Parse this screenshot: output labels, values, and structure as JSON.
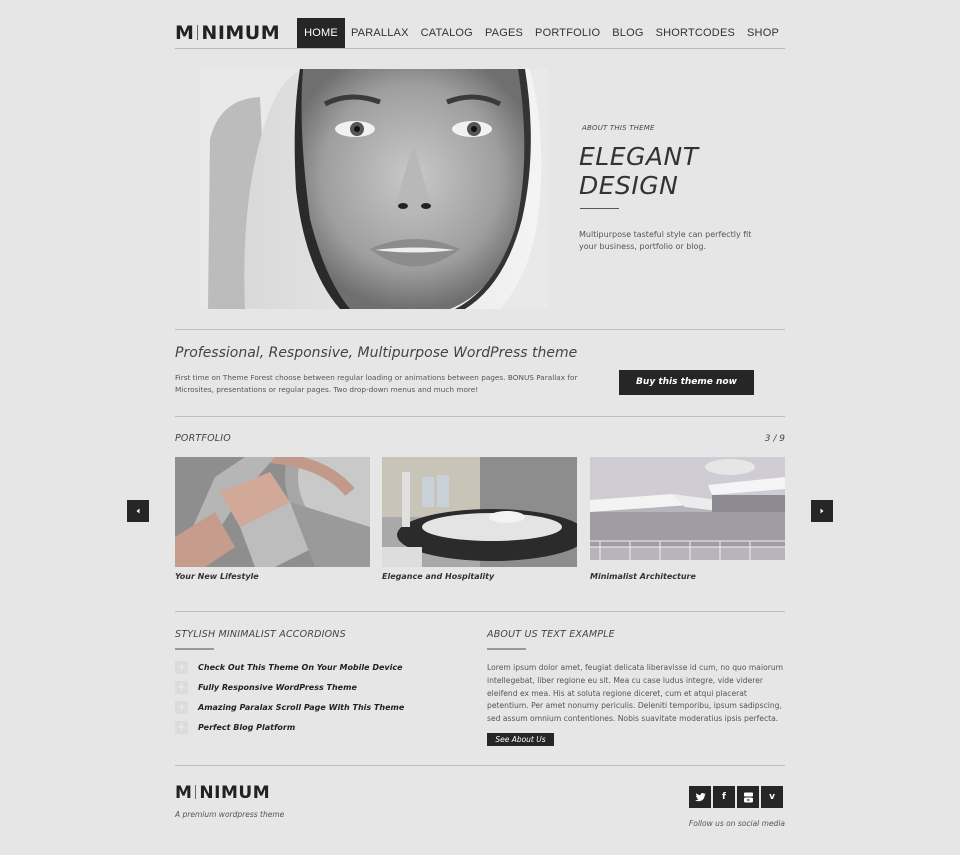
{
  "header": {
    "logo_left": "M",
    "logo_right": "NIMUM",
    "nav": [
      {
        "label": "HOME",
        "active": true
      },
      {
        "label": "PARALLAX"
      },
      {
        "label": "CATALOG"
      },
      {
        "label": "PAGES"
      },
      {
        "label": "PORTFOLIO"
      },
      {
        "label": "BLOG"
      },
      {
        "label": "SHORTCODES"
      },
      {
        "label": "SHOP"
      }
    ]
  },
  "hero": {
    "eyebrow": "ABOUT THIS THEME",
    "title_line1": "ELEGANT",
    "title_line2": "DESIGN",
    "text": "Multipurpose tasteful style can perfectly fit your business, portfolio or blog.",
    "image": "black-and-white portrait of woman in white headscarf"
  },
  "promo": {
    "title": "Professional, Responsive, Multipurpose WordPress theme",
    "text": "First time on Theme Forest choose between regular loading or animations between pages. BONUS Parallax for Microsites, presentations or regular pages. Two drop-down menus and much more!",
    "button": "Buy this theme now"
  },
  "portfolio": {
    "title": "PORTFOLIO",
    "pager": "3 / 9",
    "prev_icon": "arrow-left-icon",
    "next_icon": "arrow-right-icon",
    "items": [
      {
        "caption": "Your New Lifestyle",
        "image": "rose gold watch bracelet closeup"
      },
      {
        "caption": "Elegance and Hospitality",
        "image": "restaurant table setting with glasses"
      },
      {
        "caption": "Minimalist Architecture",
        "image": "modern white building terrace"
      }
    ]
  },
  "accordions": {
    "title": "STYLISH MINIMALIST ACCORDIONS",
    "items": [
      {
        "label": "Check Out This Theme On Your Mobile Device"
      },
      {
        "label": "Fully Responsive WordPress Theme"
      },
      {
        "label": "Amazing Paralax Scroll Page With This Theme"
      },
      {
        "label": "Perfect Blog Platform"
      }
    ],
    "plus_symbol": "+"
  },
  "about": {
    "title": "ABOUT US TEXT EXAMPLE",
    "text": "Lorem ipsum dolor amet, feugiat delicata liberavisse id cum, no quo maiorum intellegebat, liber regione eu sit. Mea cu case ludus integre, vide viderer eleifend ex mea. His at soluta regione diceret, cum et atqui placerat petentium. Per amet nonumy periculis. Deleniti temporibu, ipsum sadipscing, sed assum omnium contentiones. Nobis suavitate moderatius ipsis perfecta.",
    "button": "See About Us"
  },
  "footer": {
    "logo_left": "M",
    "logo_right": "NIMUM",
    "tagline": "A premium wordpress theme",
    "social": [
      {
        "name": "twitter-icon",
        "glyph": "t"
      },
      {
        "name": "facebook-icon",
        "glyph": "f"
      },
      {
        "name": "youtube-icon",
        "glyph": "▶"
      },
      {
        "name": "vimeo-icon",
        "glyph": "v"
      }
    ],
    "follow": "Follow us on social media"
  }
}
